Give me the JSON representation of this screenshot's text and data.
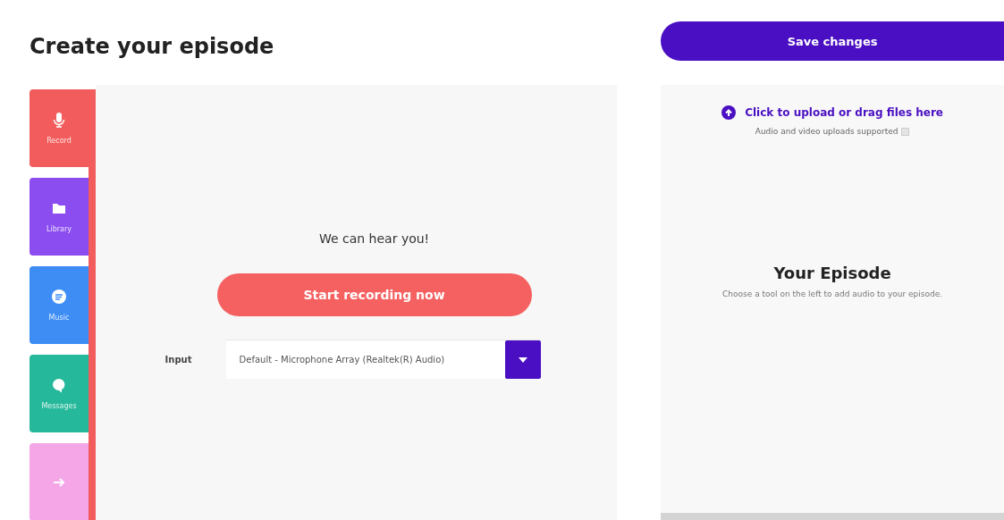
{
  "page": {
    "title": "Create your episode"
  },
  "save_button": {
    "label": "Save changes"
  },
  "tools": [
    {
      "label": "Record",
      "kind": "mic",
      "color": "#f25c5c",
      "selected": true
    },
    {
      "label": "Library",
      "kind": "folder",
      "color": "#8b4cf0",
      "selected": false
    },
    {
      "label": "Music",
      "kind": "music",
      "color": "#3d8df5",
      "selected": false
    },
    {
      "label": "Messages",
      "kind": "message",
      "color": "#26b89a",
      "selected": false
    },
    {
      "kind": "arrow",
      "color": "#f4a6e6",
      "selected": false
    }
  ],
  "recorder": {
    "status": "We can hear you!",
    "record_button": "Start recording now",
    "input_label": "Input",
    "input_value": "Default - Microphone Array (Realtek(R) Audio)"
  },
  "episode": {
    "upload_link": "Click to upload or drag files here",
    "upload_note": "Audio and video uploads supported",
    "title": "Your Episode",
    "hint": "Choose a tool on the left to add audio to your episode."
  }
}
